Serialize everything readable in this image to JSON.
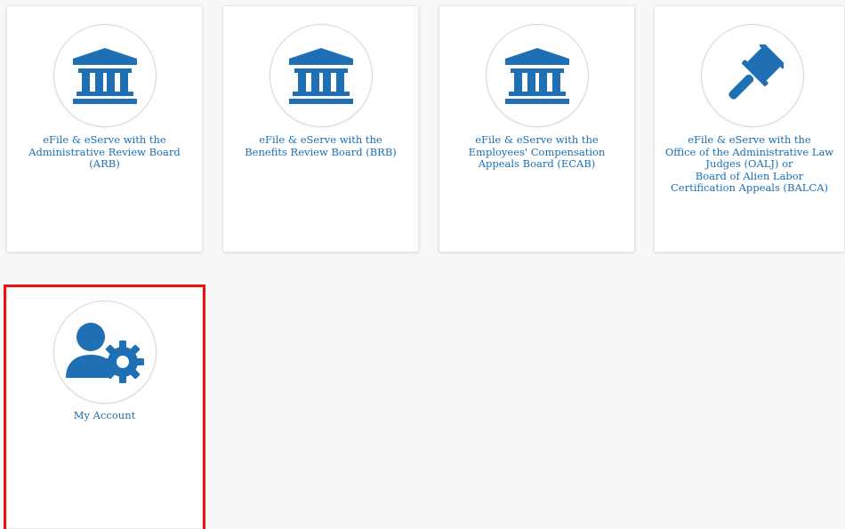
{
  "tiles": [
    {
      "icon": "courthouse-icon",
      "lines": [
        "eFile & eServe with the",
        "Administrative Review Board",
        "(ARB)"
      ]
    },
    {
      "icon": "courthouse-icon",
      "lines": [
        "eFile & eServe with the",
        "Benefits Review Board (BRB)"
      ]
    },
    {
      "icon": "courthouse-icon",
      "lines": [
        "eFile & eServe with the",
        "Employees' Compensation",
        "Appeals Board (ECAB)"
      ]
    },
    {
      "icon": "gavel-icon",
      "lines": [
        "eFile & eServe with the",
        "Office of the Administrative Law",
        "Judges (OALJ) or",
        "Board of Alien Labor",
        "Certification Appeals (BALCA)"
      ]
    },
    {
      "icon": "user-settings-icon",
      "lines": [
        "My Account"
      ]
    }
  ],
  "colors": {
    "accent": "#1a6fb3",
    "icon_fill": "#1f6fb5",
    "highlight": "#ee1111",
    "card_bg": "#ffffff",
    "page_bg": "#f8f8f8"
  }
}
